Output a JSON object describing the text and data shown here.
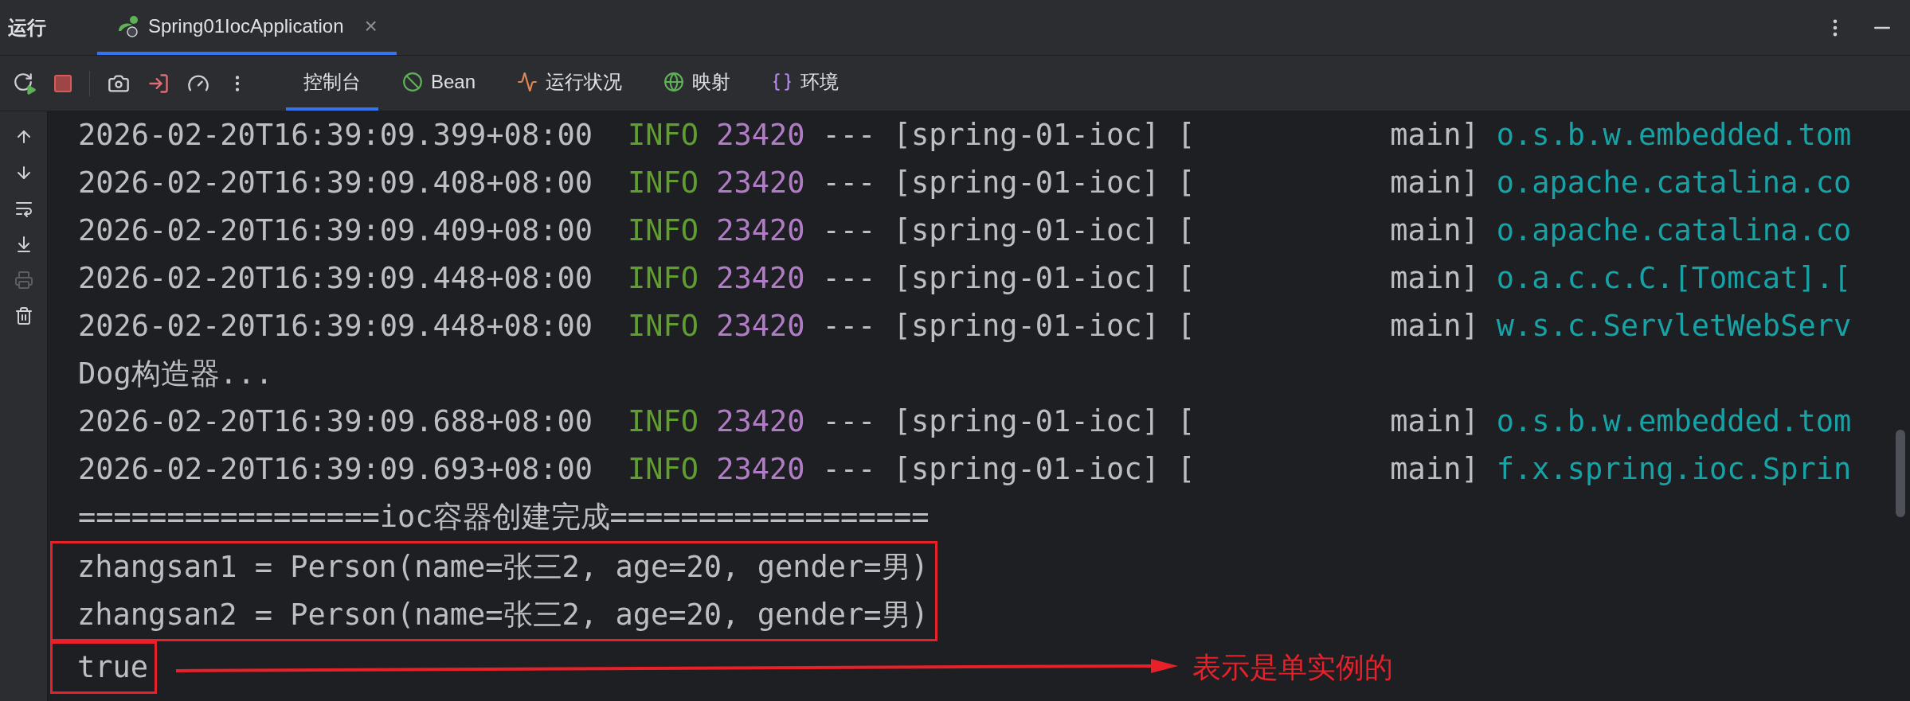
{
  "panel": {
    "title": "运行",
    "tabs": [
      {
        "label": "Spring01IocApplication",
        "selected": true,
        "close": "×"
      }
    ]
  },
  "toolbar": {
    "tools": [
      {
        "kind": "rerun"
      },
      {
        "kind": "stop"
      },
      {
        "kind": "divider"
      },
      {
        "kind": "camera"
      },
      {
        "kind": "exit"
      },
      {
        "kind": "gauge"
      },
      {
        "kind": "more"
      }
    ],
    "tabs": [
      {
        "label": "控制台",
        "kind": "console",
        "selected": true
      },
      {
        "label": "Bean",
        "kind": "bean",
        "selected": false
      },
      {
        "label": "运行状况",
        "kind": "health",
        "selected": false
      },
      {
        "label": "映射",
        "kind": "mapping",
        "selected": false
      },
      {
        "label": "环境",
        "kind": "env",
        "selected": false
      }
    ]
  },
  "sidebar_tools": [
    {
      "kind": "up",
      "disabled": false
    },
    {
      "kind": "down",
      "disabled": false
    },
    {
      "kind": "wrap",
      "disabled": false
    },
    {
      "kind": "scroll-end",
      "disabled": false
    },
    {
      "kind": "print",
      "disabled": true
    },
    {
      "kind": "trash",
      "disabled": false
    }
  ],
  "console": {
    "lines": [
      {
        "kind": "log",
        "timestamp": "2026-02-20T16:39:09.399+08:00",
        "level": "INFO",
        "pid": "23420",
        "app": "--- [spring-01-ioc] [           main]",
        "logger": "o.s.b.w.embedded.tom"
      },
      {
        "kind": "log",
        "timestamp": "2026-02-20T16:39:09.408+08:00",
        "level": "INFO",
        "pid": "23420",
        "app": "--- [spring-01-ioc] [           main]",
        "logger": "o.apache.catalina.co"
      },
      {
        "kind": "log",
        "timestamp": "2026-02-20T16:39:09.409+08:00",
        "level": "INFO",
        "pid": "23420",
        "app": "--- [spring-01-ioc] [           main]",
        "logger": "o.apache.catalina.co"
      },
      {
        "kind": "log",
        "timestamp": "2026-02-20T16:39:09.448+08:00",
        "level": "INFO",
        "pid": "23420",
        "app": "--- [spring-01-ioc] [           main]",
        "logger": "o.a.c.c.C.[Tomcat].["
      },
      {
        "kind": "log",
        "timestamp": "2026-02-20T16:39:09.448+08:00",
        "level": "INFO",
        "pid": "23420",
        "app": "--- [spring-01-ioc] [           main]",
        "logger": "w.s.c.ServletWebServ"
      },
      {
        "kind": "text",
        "text": "Dog构造器..."
      },
      {
        "kind": "log",
        "timestamp": "2026-02-20T16:39:09.688+08:00",
        "level": "INFO",
        "pid": "23420",
        "app": "--- [spring-01-ioc] [           main]",
        "logger": "o.s.b.w.embedded.tom"
      },
      {
        "kind": "log",
        "timestamp": "2026-02-20T16:39:09.693+08:00",
        "level": "INFO",
        "pid": "23420",
        "app": "--- [spring-01-ioc] [           main]",
        "logger": "f.x.spring.ioc.Sprin"
      },
      {
        "kind": "text",
        "text": "=================ioc容器创建完成=================="
      },
      {
        "kind": "highlight",
        "lines": [
          {
            "kind": "text",
            "text": "zhangsan1 = Person(name=张三2, age=20, gender=男)"
          },
          {
            "kind": "text",
            "text": "zhangsan2 = Person(name=张三2, age=20, gender=男)"
          }
        ]
      },
      {
        "kind": "highlight",
        "lines": [
          {
            "kind": "text",
            "text": "true"
          }
        ],
        "callout": "表示是单实例的"
      }
    ]
  }
}
